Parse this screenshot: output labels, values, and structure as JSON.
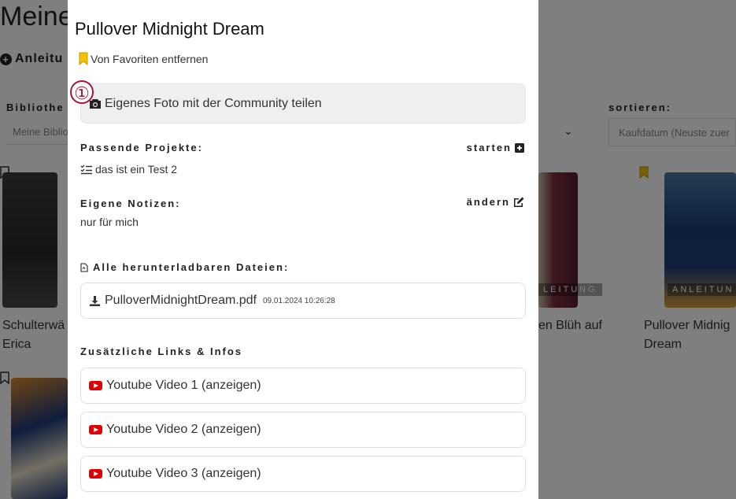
{
  "background": {
    "page_title": "Meine",
    "add_link": "Anleitu",
    "filter_label": "Bibliothe",
    "filter_value": "Meine Biblio",
    "sort_label": "sortieren:",
    "sort_value": "Kaufdatum (Neuste zuer",
    "cards": [
      {
        "line1": "Schulterwä",
        "line2": "Erica"
      },
      {
        "line1": "en Blüh auf",
        "line2": ""
      },
      {
        "line1": "Pullover Midnig",
        "line2": "Dream",
        "badge": "ANLEITUN"
      }
    ],
    "middle_badge": "LEITUNG"
  },
  "modal": {
    "title": "Pullover Midnight Dream",
    "favorite_label": "Von Favoriten entfernen",
    "share_label": "Eigenes Foto mit der Community teilen",
    "step_marker": "①",
    "projects": {
      "label": "Passende Projekte:",
      "action": "starten",
      "item": "das ist ein Test 2"
    },
    "notes": {
      "label": "Eigene Notizen:",
      "action": "ändern",
      "text": "nur für mich"
    },
    "files": {
      "label": "Alle herunterladbaren Dateien:",
      "file_name": "PulloverMidnightDream.pdf",
      "file_date": "09.01.2024 10:26:28"
    },
    "links": {
      "label": "Zusätzliche Links & Infos",
      "items": [
        "Youtube Video 1 (anzeigen)",
        "Youtube Video 2 (anzeigen)",
        "Youtube Video 3 (anzeigen)"
      ]
    }
  },
  "colors": {
    "accent_marker": "#a4193a",
    "youtube": "#e20000",
    "bookmark": "#f2c200"
  }
}
